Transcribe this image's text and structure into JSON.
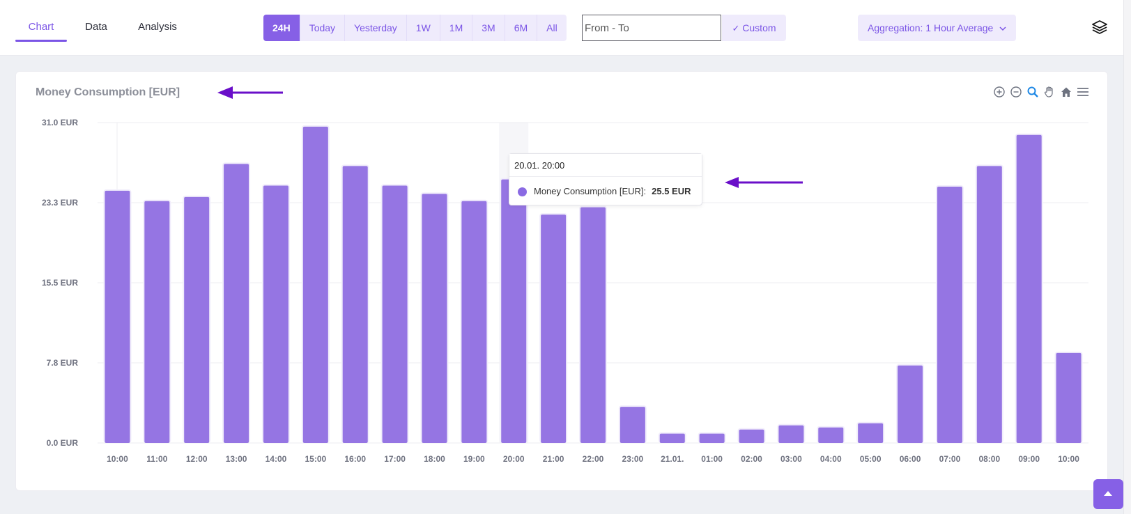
{
  "tabs": [
    {
      "label": "Chart",
      "active": true
    },
    {
      "label": "Data",
      "active": false
    },
    {
      "label": "Analysis",
      "active": false
    }
  ],
  "ranges": [
    {
      "label": "24H",
      "active": true
    },
    {
      "label": "Today",
      "active": false
    },
    {
      "label": "Yesterday",
      "active": false
    },
    {
      "label": "1W",
      "active": false
    },
    {
      "label": "1M",
      "active": false
    },
    {
      "label": "3M",
      "active": false
    },
    {
      "label": "6M",
      "active": false
    },
    {
      "label": "All",
      "active": false
    }
  ],
  "range_input": {
    "placeholder": "From - To",
    "value": ""
  },
  "custom_button": {
    "label": "Custom",
    "icon": "check-icon"
  },
  "aggregation": {
    "label": "Aggregation: 1 Hour Average",
    "icon": "chevron-down-icon"
  },
  "layers_icon": "layers-icon",
  "colors": {
    "accent": "#7b55e6",
    "bar": "#9575e3",
    "annotation_arrow": "#6a0fc9"
  },
  "chart_toolbar": [
    "zoom-in-icon",
    "zoom-out-icon",
    "zoom-select-icon",
    "pan-hand-icon",
    "home-reset-icon",
    "menu-icon"
  ],
  "tooltip": {
    "header": "20.01. 20:00",
    "series_label": "Money Consumption [EUR]:",
    "value": "25.5 EUR"
  },
  "chart_data": {
    "type": "bar",
    "title": "Money Consumption [EUR]",
    "xlabel": "",
    "ylabel": "",
    "categories": [
      "10:00",
      "11:00",
      "12:00",
      "13:00",
      "14:00",
      "15:00",
      "16:00",
      "17:00",
      "18:00",
      "19:00",
      "20:00",
      "21:00",
      "22:00",
      "23:00",
      "21.01.",
      "01:00",
      "02:00",
      "03:00",
      "04:00",
      "05:00",
      "06:00",
      "07:00",
      "08:00",
      "09:00",
      "10:00"
    ],
    "series": [
      {
        "name": "Money Consumption [EUR]",
        "values": [
          24.4,
          23.4,
          23.8,
          27.0,
          24.9,
          30.6,
          26.8,
          24.9,
          24.1,
          23.4,
          25.5,
          22.1,
          22.8,
          3.5,
          0.9,
          0.9,
          1.3,
          1.7,
          1.5,
          1.9,
          7.5,
          24.8,
          26.8,
          29.8,
          8.7
        ]
      }
    ],
    "ylim": [
      0,
      31.0
    ],
    "yticks": [
      "0.0 EUR",
      "7.8 EUR",
      "15.5 EUR",
      "23.3 EUR",
      "31.0 EUR"
    ],
    "ytick_values": [
      0,
      7.75,
      15.5,
      23.25,
      31.0
    ],
    "grid": true,
    "highlighted_category_index": 10
  },
  "scroll_top_button": "arrow-up-icon"
}
